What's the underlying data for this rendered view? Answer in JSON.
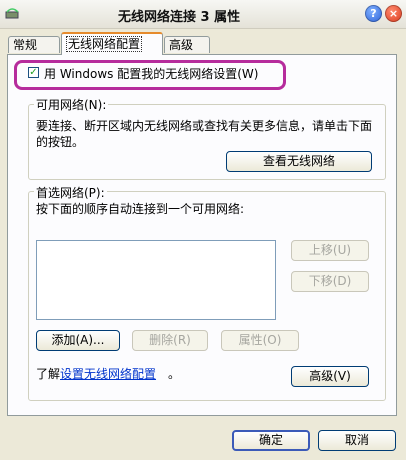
{
  "window": {
    "title": "无线网络连接 3 属性",
    "help_glyph": "?",
    "close_glyph": "×"
  },
  "tabs": [
    {
      "label": "常规"
    },
    {
      "label": "无线网络配置"
    },
    {
      "label": "高级"
    }
  ],
  "config": {
    "use_windows_label": "用 Windows 配置我的无线网络设置(W)",
    "checked": true,
    "check_glyph": "✓"
  },
  "available": {
    "title": "可用网络(N):",
    "description": "要连接、断开区域内无线网络或查找有关更多信息，请单击下面的按钮。",
    "view_button": "查看无线网络"
  },
  "preferred": {
    "title": "首选网络(P):",
    "description": "按下面的顺序自动连接到一个可用网络:",
    "move_up": "上移(U)",
    "move_down": "下移(D)",
    "add": "添加(A)...",
    "remove": "删除(R)",
    "properties": "属性(O)"
  },
  "learn": {
    "prefix": "了解",
    "link": "设置无线网络配置",
    "suffix": "。",
    "advanced_button": "高级(V)"
  },
  "footer": {
    "ok": "确定",
    "cancel": "取消"
  },
  "colors": {
    "highlight": "#b62c9c",
    "active_tab_accent": "#e68b2c",
    "link": "#0033cc"
  }
}
